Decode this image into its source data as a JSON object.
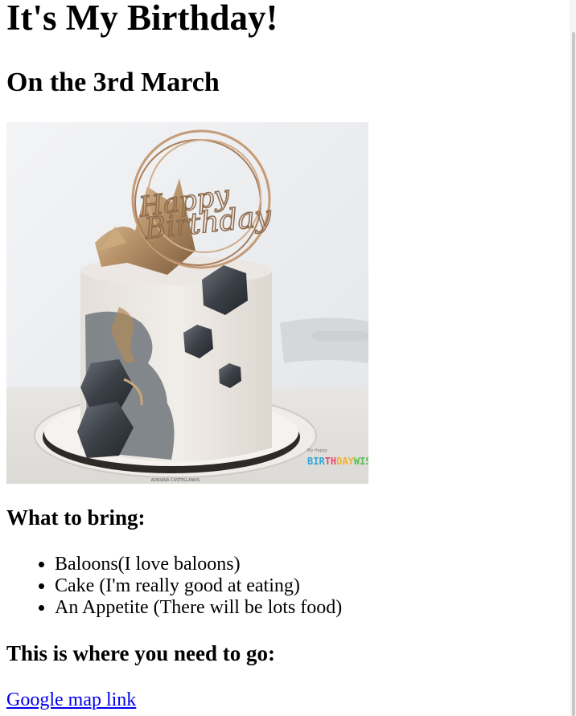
{
  "title": "It's My Birthday!",
  "subtitle": "On the 3rd March",
  "image": {
    "alt": "birthday cake",
    "cake_topper_text": "Happy Birthday",
    "watermark_small": "My Happy",
    "watermark": "BIRTHDAY WISHES",
    "board_text": "ADRIANA CASTELLANOS"
  },
  "bring_heading": "What to bring:",
  "bring_items": [
    "Baloons(I love baloons)",
    "Cake (I'm really good at eating)",
    "An Appetite (There will be lots food)"
  ],
  "where_heading": "This is where you need to go:",
  "map_link": "Google map link",
  "colors": {
    "link": "#0000ee",
    "text": "#000000",
    "background": "#ffffff"
  }
}
